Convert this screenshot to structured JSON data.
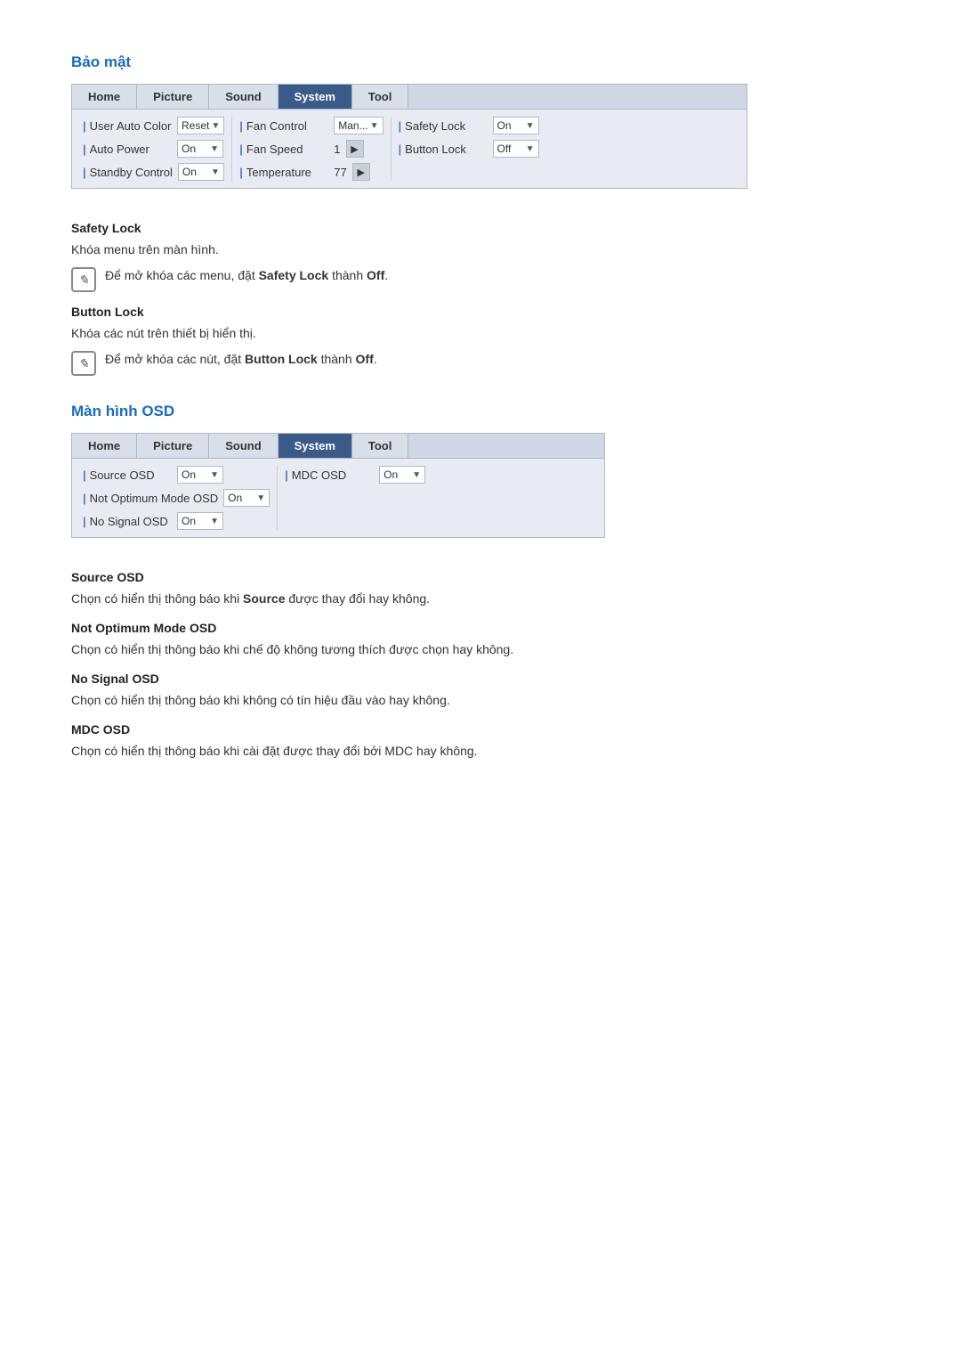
{
  "section1": {
    "title": "Bảo mật",
    "tabs": [
      "Home",
      "Picture",
      "Sound",
      "System",
      "Tool"
    ],
    "active_tab": "System",
    "col1": {
      "rows": [
        {
          "label": "User Auto Color",
          "control_type": "dropdown",
          "value": "Reset",
          "arrow": true
        },
        {
          "label": "Auto Power",
          "control_type": "dropdown",
          "value": "On"
        },
        {
          "label": "Standby Control",
          "control_type": "dropdown",
          "value": "On"
        }
      ]
    },
    "col2": {
      "rows": [
        {
          "label": "Fan Control",
          "control_type": "dropdown",
          "value": "Man..."
        },
        {
          "label": "Fan Speed",
          "control_type": "nav",
          "value": "1"
        },
        {
          "label": "Temperature",
          "control_type": "nav",
          "value": "77"
        }
      ]
    },
    "col3": {
      "rows": [
        {
          "label": "Safety Lock",
          "control_type": "dropdown",
          "value": "On"
        },
        {
          "label": "Button Lock",
          "control_type": "dropdown",
          "value": "Off"
        }
      ]
    }
  },
  "safety_lock": {
    "title": "Safety Lock",
    "description": "Khóa menu trên màn hình.",
    "note": "Để mở khóa các menu, đặt ",
    "note_bold": "Safety Lock",
    "note_end": " thành ",
    "note_bold2": "Off",
    "note_end2": "."
  },
  "button_lock": {
    "title": "Button Lock",
    "description": "Khóa các nút trên thiết bị hiển thị.",
    "note": "Để mở khóa các nút, đặt ",
    "note_bold": "Button Lock",
    "note_end": " thành ",
    "note_bold2": "Off",
    "note_end2": "."
  },
  "section2": {
    "title": "Màn hình OSD",
    "tabs": [
      "Home",
      "Picture",
      "Sound",
      "System",
      "Tool"
    ],
    "active_tab": "System",
    "col_left": {
      "rows": [
        {
          "label": "Source OSD",
          "control_type": "dropdown",
          "value": "On"
        },
        {
          "label": "Not Optimum Mode OSD",
          "control_type": "dropdown",
          "value": "On"
        },
        {
          "label": "No Signal OSD",
          "control_type": "dropdown",
          "value": "On"
        }
      ]
    },
    "col_right": {
      "rows": [
        {
          "label": "MDC OSD",
          "control_type": "dropdown",
          "value": "On"
        }
      ]
    }
  },
  "source_osd": {
    "title": "Source OSD",
    "text1": "Chọn có hiển thị thông báo khi ",
    "bold1": "Source",
    "text2": " được thay đổi hay không."
  },
  "not_optimum_osd": {
    "title": "Not Optimum Mode OSD",
    "text": "Chọn có hiển thị thông báo khi chế độ không tương thích được chọn hay không."
  },
  "no_signal_osd": {
    "title": "No Signal OSD",
    "text": "Chọn có hiển thị thông báo khi không có tín hiệu đầu vào hay không."
  },
  "mdc_osd": {
    "title": "MDC OSD",
    "text": "Chọn có hiển thị thông báo khi cài đặt được thay đổi bởi MDC hay không."
  }
}
